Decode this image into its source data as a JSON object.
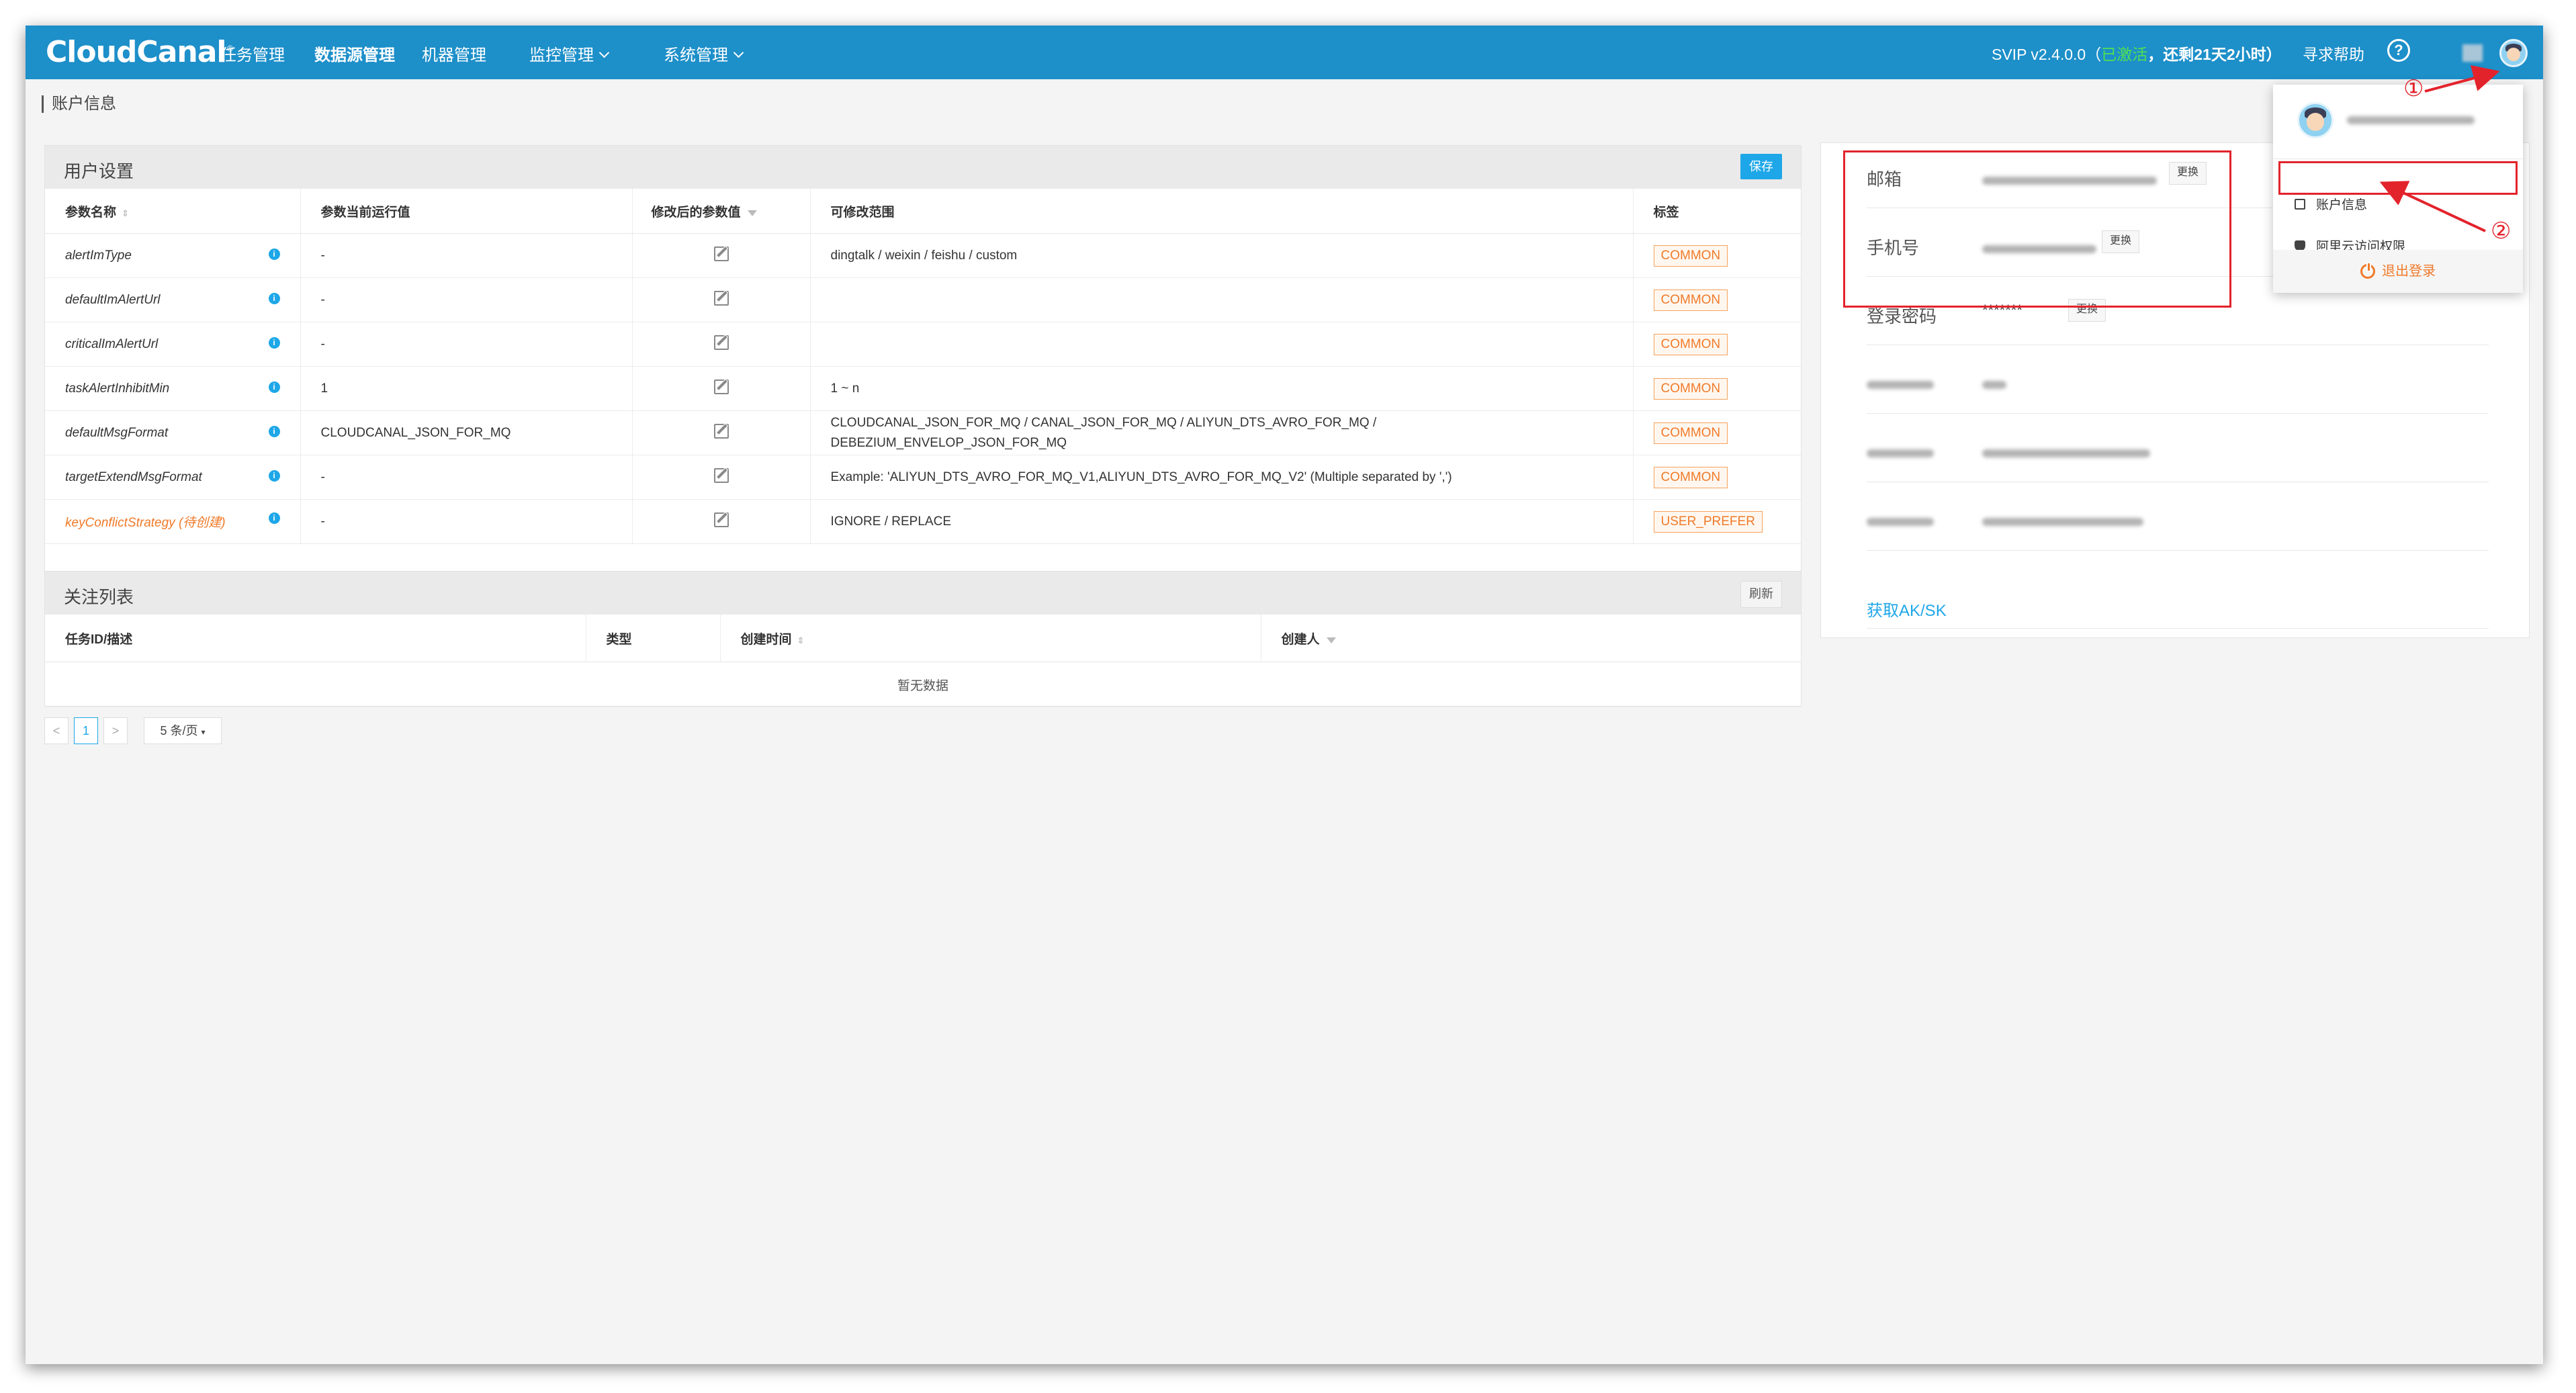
{
  "nav": {
    "logo": "CloudCanal",
    "items": [
      "任务管理",
      "数据源管理",
      "机器管理",
      "监控管理",
      "系统管理"
    ],
    "svip_prefix": "SVIP v2.4.0.0（",
    "svip_status": "已激活",
    "svip_remaining": "，还剩21天2小时）",
    "help": "寻求帮助",
    "help_icon": "?"
  },
  "breadcrumb": "账户信息",
  "settings": {
    "title": "用户设置",
    "save": "保存",
    "columns": [
      "参数名称",
      "参数当前运行值",
      "修改后的参数值",
      "可修改范围",
      "标签"
    ],
    "rows": [
      {
        "name": "alertImType",
        "value": "-",
        "range": "dingtalk / weixin / feishu / custom",
        "tag": "COMMON",
        "warn": false
      },
      {
        "name": "defaultImAlertUrl",
        "value": "-",
        "range": "",
        "tag": "COMMON",
        "warn": false
      },
      {
        "name": "criticalImAlertUrl",
        "value": "-",
        "range": "",
        "tag": "COMMON",
        "warn": false
      },
      {
        "name": "taskAlertInhibitMin",
        "value": "1",
        "range": "1 ~ n",
        "tag": "COMMON",
        "warn": false
      },
      {
        "name": "defaultMsgFormat",
        "value": "CLOUDCANAL_JSON_FOR_MQ",
        "range": "CLOUDCANAL_JSON_FOR_MQ / CANAL_JSON_FOR_MQ / ALIYUN_DTS_AVRO_FOR_MQ / DEBEZIUM_ENVELOP_JSON_FOR_MQ",
        "tag": "COMMON",
        "warn": false
      },
      {
        "name": "targetExtendMsgFormat",
        "value": "-",
        "range": "Example: 'ALIYUN_DTS_AVRO_FOR_MQ_V1,ALIYUN_DTS_AVRO_FOR_MQ_V2' (Multiple separated by ',')",
        "tag": "COMMON",
        "warn": false
      },
      {
        "name": "keyConflictStrategy (待创建)",
        "value": "-",
        "range": "IGNORE / REPLACE",
        "tag": "USER_PREFER",
        "warn": true
      }
    ]
  },
  "follow": {
    "title": "关注列表",
    "refresh": "刷新",
    "columns": [
      "任务ID/描述",
      "类型",
      "创建时间",
      "创建人"
    ],
    "empty": "暂无数据"
  },
  "pagination": {
    "prev": "<",
    "page": "1",
    "next": ">",
    "size": "5 条/页"
  },
  "account": {
    "email_label": "邮箱",
    "phone_label": "手机号",
    "password_label": "登录密码",
    "password_value": "*******",
    "change": "更换",
    "ak_link": "获取AK/SK"
  },
  "dropdown": {
    "account_info": "账户信息",
    "aliyun": "阿里云访问权限",
    "logout": "退出登录"
  },
  "annotations": {
    "one": "①",
    "two": "②"
  },
  "colors": {
    "nav": "#1d8fc9",
    "accent": "#1ea7e8",
    "tag": "#f07a2a",
    "highlight": "#e3232c"
  }
}
